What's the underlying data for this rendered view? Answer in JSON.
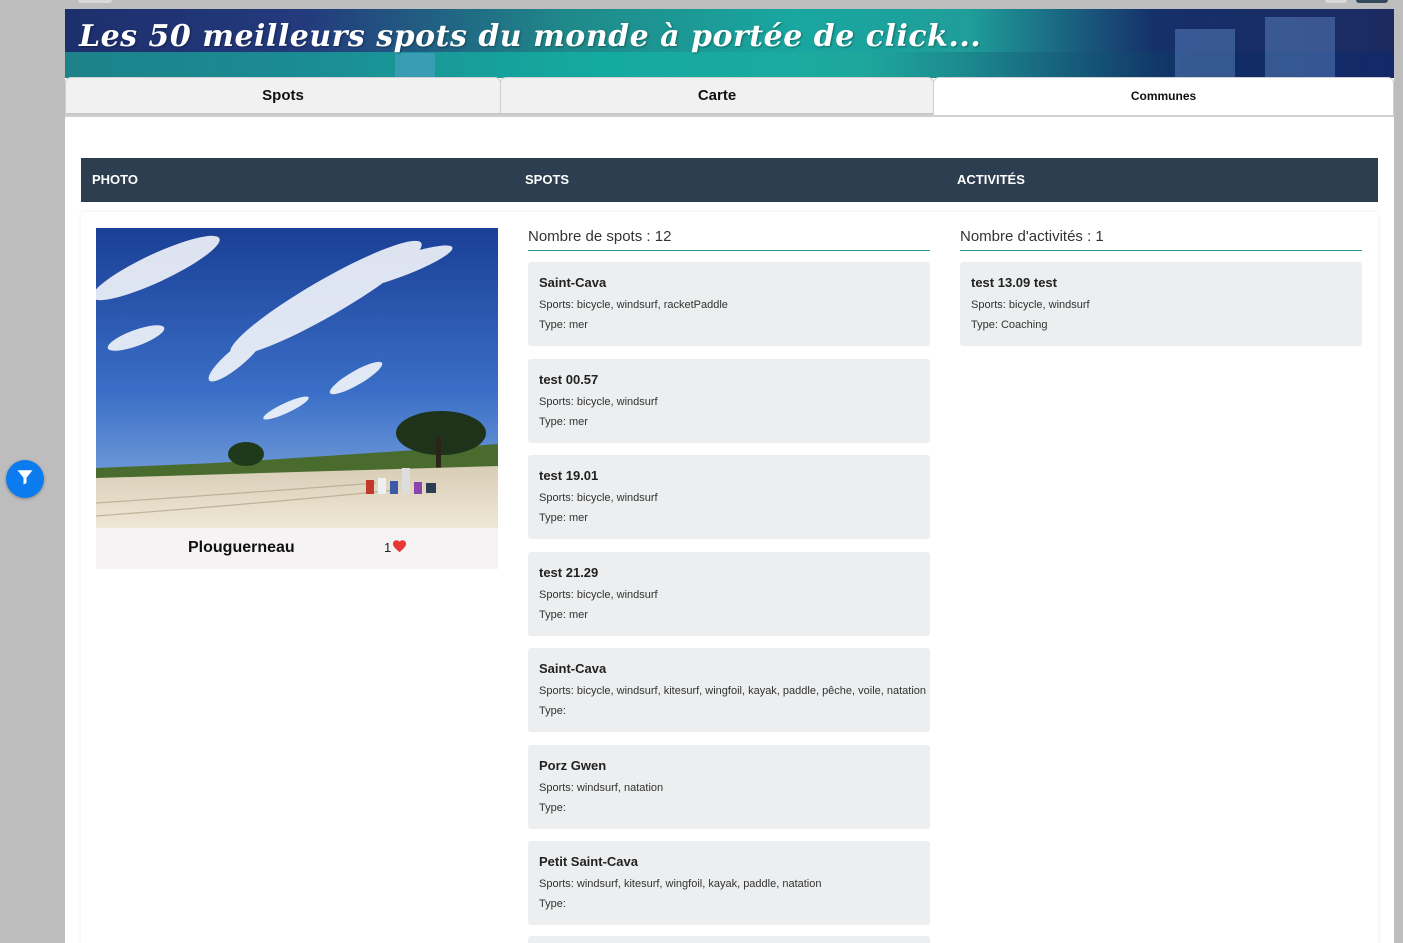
{
  "banner": {
    "title": "Les 50 meilleurs spots du monde à portée de click..."
  },
  "tabs": [
    {
      "label": "Spots",
      "active": false
    },
    {
      "label": "Carte",
      "active": false
    },
    {
      "label": "Communes",
      "active": true
    }
  ],
  "table": {
    "headers": {
      "photo": "PHOTO",
      "spots": "SPOTS",
      "activites": "ACTIVITÉS"
    }
  },
  "commune": {
    "name": "Plouguerneau",
    "likes": "1",
    "like_icon": "heart-icon",
    "like_color": "#e53935"
  },
  "spots": {
    "count_label": "Nombre de spots : 12",
    "items": [
      {
        "name": "Saint-Cava",
        "sports": "Sports: bicycle, windsurf, racketPaddle",
        "type": "Type: mer"
      },
      {
        "name": "test 00.57",
        "sports": "Sports: bicycle, windsurf",
        "type": "Type: mer"
      },
      {
        "name": "test 19.01",
        "sports": "Sports: bicycle, windsurf",
        "type": "Type: mer"
      },
      {
        "name": "test 21.29",
        "sports": "Sports: bicycle, windsurf",
        "type": "Type: mer"
      },
      {
        "name": "Saint-Cava",
        "sports": "Sports: bicycle, windsurf, kitesurf, wingfoil, kayak, paddle, pêche, voile, natation",
        "type": "Type:"
      },
      {
        "name": "Porz Gwen",
        "sports": "Sports: windsurf, natation",
        "type": "Type:"
      },
      {
        "name": "Petit Saint-Cava",
        "sports": "Sports: windsurf, kitesurf, wingfoil, kayak, paddle, natation",
        "type": "Type:"
      }
    ]
  },
  "activites": {
    "count_label": "Nombre d'activités : 1",
    "items": [
      {
        "name": "test 13.09 test",
        "sports": "Sports: bicycle, windsurf",
        "type": "Type: Coaching"
      }
    ]
  },
  "filter_button": {
    "icon": "filter-icon",
    "color": "#0d7bf0"
  },
  "colors": {
    "header_bg": "#2c3e50",
    "card_bg": "#eceeef",
    "accent_line": "#2a9a9a"
  }
}
